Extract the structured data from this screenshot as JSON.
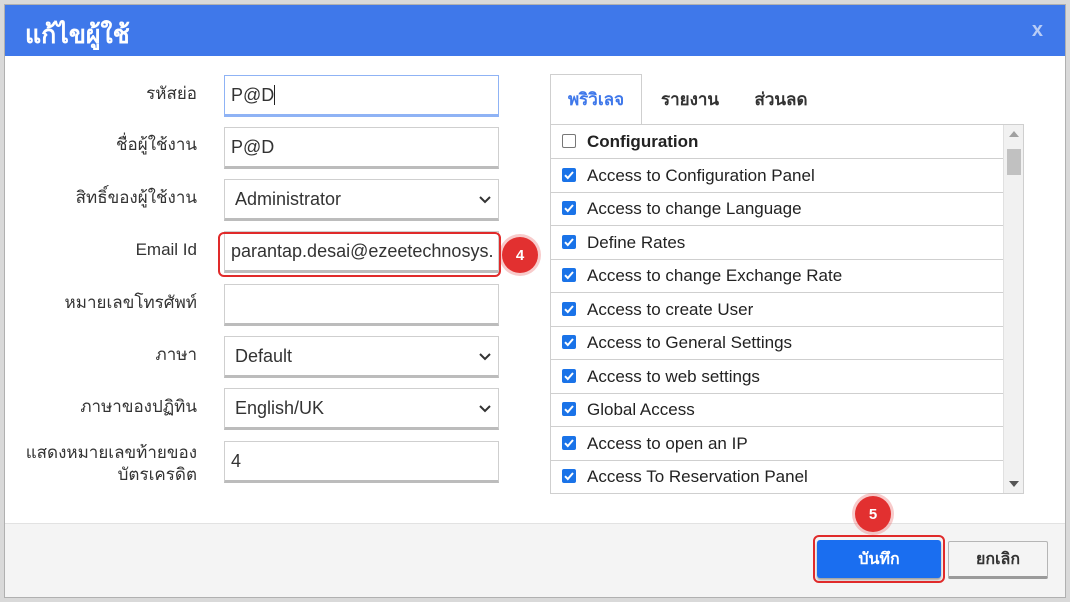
{
  "dialog": {
    "title": "แก้ไขผู้ใช้",
    "close_label": "x"
  },
  "form": {
    "short_name": {
      "label": "รหัสย่อ",
      "value": "P@D"
    },
    "username": {
      "label": "ชื่อผู้ใช้งาน",
      "value": "P@D"
    },
    "user_right": {
      "label": "สิทธิ์ของผู้ใช้งาน",
      "value": "Administrator"
    },
    "email": {
      "label": "Email Id",
      "value": "parantap.desai@ezeetechnosys.c"
    },
    "phone": {
      "label": "หมายเลขโทรศัพท์",
      "value": ""
    },
    "language": {
      "label": "ภาษา",
      "value": "Default"
    },
    "calendar_language": {
      "label": "ภาษาของปฏิทิน",
      "value": "English/UK"
    },
    "card_digits": {
      "label_line1": "แสดงหมายเลขท้ายของ",
      "label_line2": "บัตรเครดิต",
      "value": "4"
    }
  },
  "tabs": [
    {
      "label": "พริวิเลจ",
      "active": true
    },
    {
      "label": "รายงาน",
      "active": false
    },
    {
      "label": "ส่วนลด",
      "active": false
    }
  ],
  "privileges": {
    "group_label": "Configuration",
    "group_checked": false,
    "items": [
      {
        "label": "Access to Configuration Panel",
        "checked": true
      },
      {
        "label": "Access to change Language",
        "checked": true
      },
      {
        "label": "Define Rates",
        "checked": true
      },
      {
        "label": "Access to change Exchange Rate",
        "checked": true
      },
      {
        "label": "Access to create User",
        "checked": true
      },
      {
        "label": "Access to General Settings",
        "checked": true
      },
      {
        "label": "Access to web settings",
        "checked": true
      },
      {
        "label": "Global Access",
        "checked": true
      },
      {
        "label": "Access to open an IP",
        "checked": true
      },
      {
        "label": "Access To Reservation Panel",
        "checked": true
      }
    ]
  },
  "buttons": {
    "save": "บันทึก",
    "cancel": "ยกเลิก"
  },
  "markers": {
    "email_step": "4",
    "save_step": "5"
  },
  "colors": {
    "titlebar": "#3f78ea",
    "primary": "#1a6ef0",
    "highlight": "#e02a2a",
    "checkbox": "#1a73e8"
  }
}
